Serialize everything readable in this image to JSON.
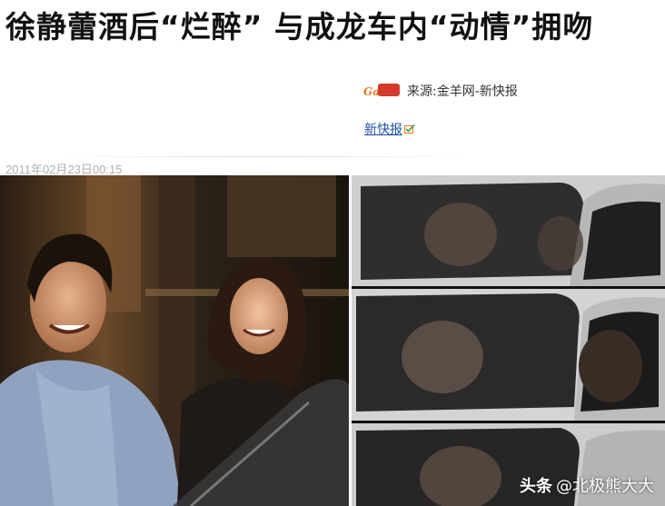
{
  "headline": "徐静蕾酒后“烂醉” 与成龙车内“动情”拥吻",
  "source": {
    "logo_icon": "jinyang-logo-icon",
    "text": "来源:金羊网-新快报"
  },
  "tag": {
    "label": "新快报",
    "icon": "check-badge-icon"
  },
  "timestamp": "2011年02月23日00:15",
  "watermark": {
    "brand": "头条",
    "handle": "@北极熊大大"
  },
  "colors": {
    "link": "#2050a8",
    "timestamp": "#b0b0b0",
    "logo_orange": "#e8731c",
    "logo_red": "#d5392b"
  }
}
